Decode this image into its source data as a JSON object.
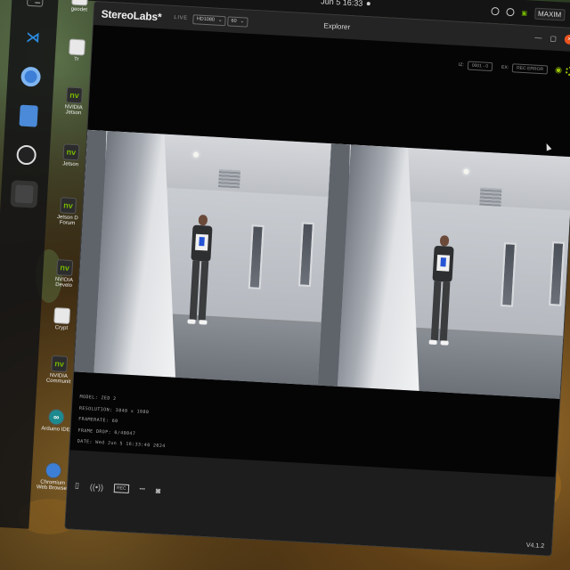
{
  "topbar": {
    "clock": "Jun 5 16:33",
    "tray_user": "MAXIM"
  },
  "dock": {
    "items": [
      {
        "name": "terminal-icon",
        "glyph": ">_"
      },
      {
        "name": "vscode-icon",
        "glyph": "⟨⟩"
      },
      {
        "name": "chromium-icon",
        "glyph": "◉"
      },
      {
        "name": "files-icon",
        "glyph": "▤"
      },
      {
        "name": "obs-icon",
        "glyph": "◎"
      },
      {
        "name": "app-icon",
        "glyph": "▢"
      }
    ]
  },
  "desktop": {
    "icons": [
      {
        "label": "geodet",
        "kind": "file"
      },
      {
        "label": "Tr",
        "kind": "file"
      },
      {
        "label": "NVIDIA Jetson",
        "kind": "nv"
      },
      {
        "label": "Jetson",
        "kind": "nv"
      },
      {
        "label": "Jetson D Forum",
        "kind": "nv"
      },
      {
        "label": "NVIDIA Develo",
        "kind": "nv"
      },
      {
        "label": "Crypt",
        "kind": "file"
      },
      {
        "label": "NVIDIA Communit",
        "kind": "nv"
      },
      {
        "label": "Arduino IDE",
        "kind": "arduino"
      },
      {
        "label": "Chromium Web Browser",
        "kind": "chromium"
      }
    ]
  },
  "app": {
    "brand": "StereoLabs*",
    "live_label": "LIVE",
    "resolution_select": "HD1080",
    "fps_select": "60",
    "window_title": "Explorer",
    "toolbar": {
      "iz_label": "IZ:",
      "iz_value": "0001 - 0",
      "ex_label": "EX:",
      "ex_value": "REC ERROR"
    },
    "metadata": {
      "model": "MODEL: ZED 2",
      "resolution": "RESOLUTION: 3840 x 1080",
      "framerate": "FRAMERATE: 60",
      "frame_drop": "FRAME DROP: 0/40047",
      "date": "DATE: Wed Jun 5 16:33:40 2024"
    },
    "bottom": {
      "rec_label": "REC",
      "version": "V4.1.2"
    }
  },
  "colors": {
    "accent_green": "#9bc400",
    "nvidia_green": "#76b900",
    "ubuntu_orange": "#e95420"
  }
}
